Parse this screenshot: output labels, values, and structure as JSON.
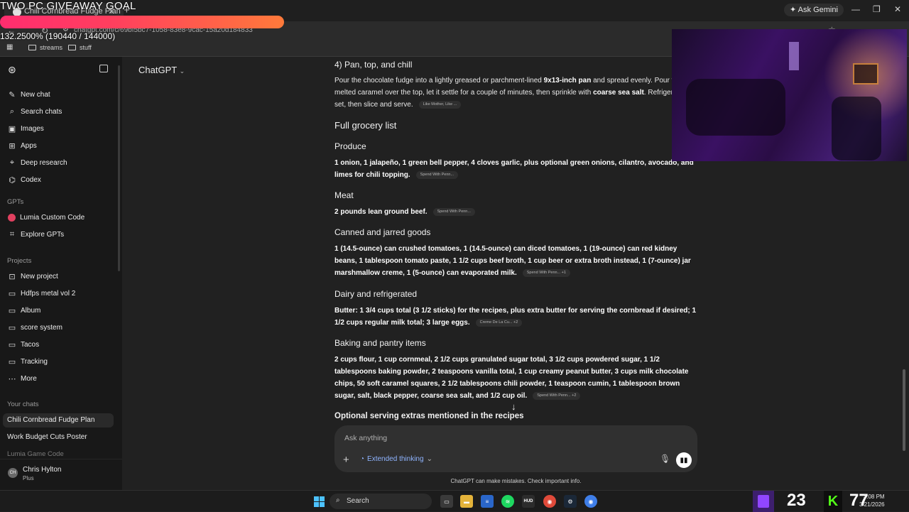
{
  "overlay": {
    "giveaway_title": "TWO PC GIVEAWAY GOAL",
    "giveaway_stats": "132.2500% (190440 / 144000)",
    "stream_count_left": "23",
    "stream_count_right": "77"
  },
  "browser": {
    "tab_title": "Chili Cornbread Fudge Plan",
    "url": "chatgpt.com/c/69bf5bc7-1058-83e8-9cac-15a20d184833",
    "ask_gemini": "Ask Gemini",
    "bookmarks": [
      "streams",
      "stuff"
    ]
  },
  "sidebar": {
    "actions": [
      {
        "label": "New chat",
        "icon": "edit-icon"
      },
      {
        "label": "Search chats",
        "icon": "search-icon"
      },
      {
        "label": "Images",
        "icon": "image-icon"
      },
      {
        "label": "Apps",
        "icon": "apps-icon"
      },
      {
        "label": "Deep research",
        "icon": "research-icon"
      },
      {
        "label": "Codex",
        "icon": "codex-icon"
      }
    ],
    "gpts_heading": "GPTs",
    "gpts": [
      "Lumia Custom Code",
      "Explore GPTs"
    ],
    "projects_heading": "Projects",
    "projects": [
      "New project",
      "Hdfps metal vol 2",
      "Album",
      "score system",
      "Tacos",
      "Tracking",
      "More"
    ],
    "chats_heading": "Your chats",
    "chats": [
      "Chili Cornbread Fudge Plan",
      "Work Budget Cuts Poster",
      "Lumia Game Code"
    ],
    "user": {
      "name": "Chris Hylton",
      "plan": "Plus",
      "initials": "CH"
    }
  },
  "header": {
    "model": "ChatGPT"
  },
  "article": {
    "step4_title": "4) Pan, top, and chill",
    "step4_text_a": "Pour the chocolate fudge into a lightly greased or parchment-lined ",
    "step4_bold_a": "9x13-inch pan",
    "step4_text_b": " and spread evenly. Pour the melted caramel over the top, let it settle for a couple of minutes, then sprinkle with ",
    "step4_bold_b": "coarse sea salt",
    "step4_text_c": ". Refrigerate until set, then slice and serve.",
    "step4_cite": "Like Mother, Like ...",
    "grocery_title": "Full grocery list",
    "produce_title": "Produce",
    "produce_text": "1 onion, 1 jalapeño, 1 green bell pepper, 4 cloves garlic, plus optional green onions, cilantro, avocado, and limes for chili topping.",
    "produce_cite": "Spend With Penn...",
    "meat_title": "Meat",
    "meat_text": "2 pounds lean ground beef.",
    "meat_cite": "Spend With Penn...",
    "canned_title": "Canned and jarred goods",
    "canned_text": "1 (14.5-ounce) can crushed tomatoes, 1 (14.5-ounce) can diced tomatoes, 1 (19-ounce) can red kidney beans, 1 tablespoon tomato paste, 1 1/2 cups beef broth, 1 cup beer or extra broth instead, 1 (7-ounce) jar marshmallow creme, 1 (5-ounce) can evaporated milk.",
    "canned_cite": "Spend With Penn... +1",
    "dairy_title": "Dairy and refrigerated",
    "dairy_text": "Butter: 1 3/4 cups total (3 1/2 sticks) for the recipes, plus extra butter for serving the cornbread if desired; 1 1/2 cups regular milk total; 3 large eggs.",
    "dairy_cite": "Creme De La Cu... +2",
    "baking_title": "Baking and pantry items",
    "baking_text": "2 cups flour, 1 cup cornmeal, 2 1/2 cups granulated sugar total, 3 1/2 cups powdered sugar, 1 1/2 tablespoons baking powder, 2 teaspoons vanilla total, 1 cup creamy peanut butter, 3 cups milk chocolate chips, 50 soft caramel squares, 2 1/2 tablespoons chili powder, 1 teaspoon cumin, 1 tablespoon brown sugar, salt, black pepper, coarse sea salt, and 1/2 cup oil.",
    "baking_cite": "Spend With Penn... +2",
    "optional_title": "Optional serving extras mentioned in the recipes"
  },
  "composer": {
    "placeholder": "Ask anything",
    "mode_label": "Extended thinking",
    "disclaimer": "ChatGPT can make mistakes. Check important info."
  },
  "taskbar": {
    "search_label": "Search",
    "time": "3:08 PM",
    "date": "3/21/2026"
  },
  "colors": {
    "accent_link": "#8fb4ff",
    "giveaway_bar": "#ff2d6f",
    "background": "#212121",
    "sidebar": "#181818"
  }
}
